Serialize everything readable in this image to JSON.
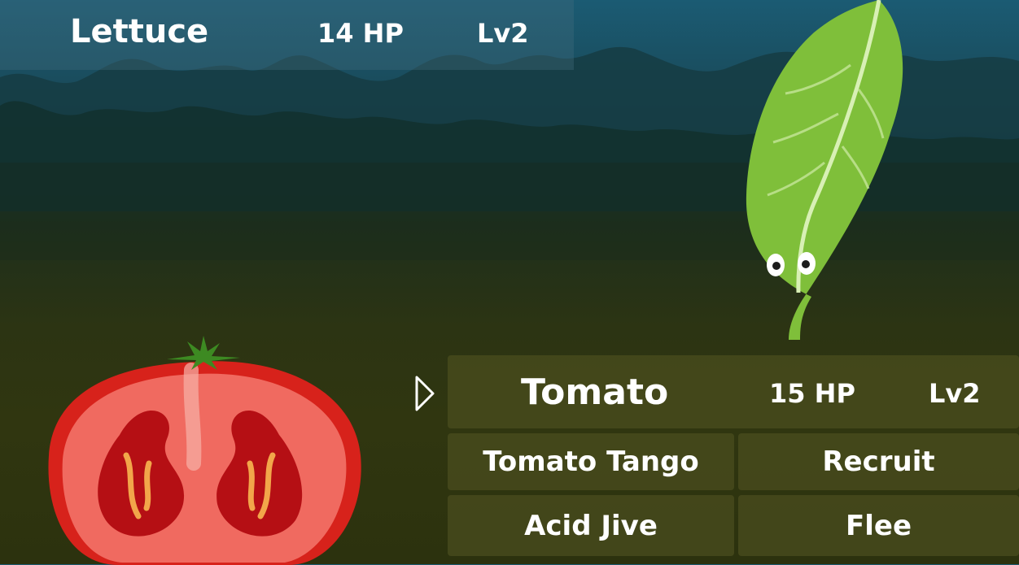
{
  "enemy": {
    "name": "Lettuce",
    "hp": "14 HP",
    "level": "Lv2"
  },
  "player": {
    "name": "Tomato",
    "hp": "15 HP",
    "level": "Lv2"
  },
  "moves": [
    "Tomato Tango",
    "Recruit",
    "Acid Jive",
    "Flee"
  ],
  "selection_cursor_icon": "triangle-pointer-icon"
}
